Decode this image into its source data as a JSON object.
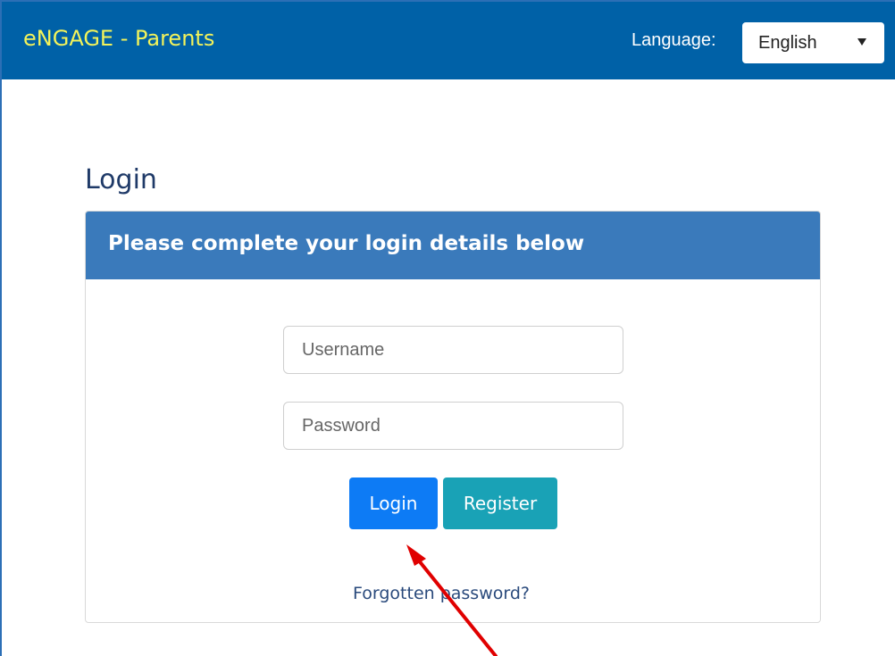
{
  "header": {
    "brand": "eNGAGE - Parents",
    "language_label": "Language:",
    "language_selected": "English"
  },
  "page": {
    "title": "Login"
  },
  "login_panel": {
    "title": "Please complete your login details below",
    "username_placeholder": "Username",
    "password_placeholder": "Password",
    "login_button": "Login",
    "register_button": "Register",
    "forgot_link": "Forgotten password?"
  },
  "colors": {
    "navbar": "#0061a7",
    "brand_text": "#f3f35a",
    "panel_header": "#3a7abb",
    "login_button": "#0d7bf5",
    "register_button": "#19a2b6",
    "annotation_arrow": "#e00000"
  },
  "icons": {
    "language_dropdown": "chevron-down-icon",
    "annotation": "red-arrow"
  }
}
